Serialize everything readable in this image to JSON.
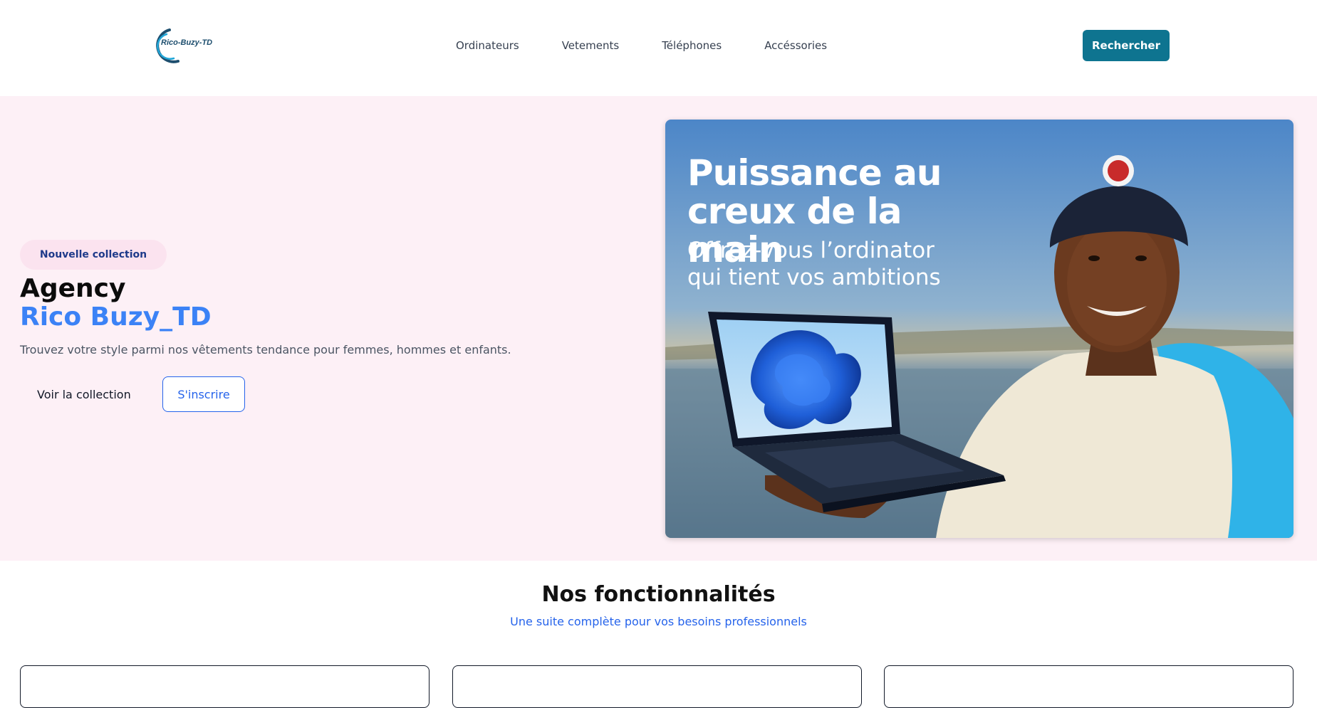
{
  "header": {
    "logo_text": "Rico-Buzy-TD",
    "nav": [
      "Ordinateurs",
      "Vetements",
      "Téléphones",
      "Accéssories"
    ],
    "search_label": "Rechercher"
  },
  "hero": {
    "badge": "Nouvelle collection",
    "title": "Agency",
    "title_highlight": "Rico Buzy_TD",
    "description": "Trouvez votre style parmi nos vêtements tendance pour femmes, hommes et enfants.",
    "primary_cta": "Voir la collection",
    "secondary_cta": "S'inscrire",
    "banner": {
      "headline": "Puissance au creux de la main",
      "subline": "Offrez-vous l’ordinator qui tient vos ambitions"
    }
  },
  "features": {
    "title": "Nos fonctionnalités",
    "subtitle": "Une suite complète pour vos besoins professionnels"
  },
  "colors": {
    "primary": "#0e7490",
    "accent_blue": "#3b82f6",
    "link_blue": "#2563eb",
    "hero_bg": "#fdf0f6",
    "badge_bg": "#fbe3ef"
  }
}
